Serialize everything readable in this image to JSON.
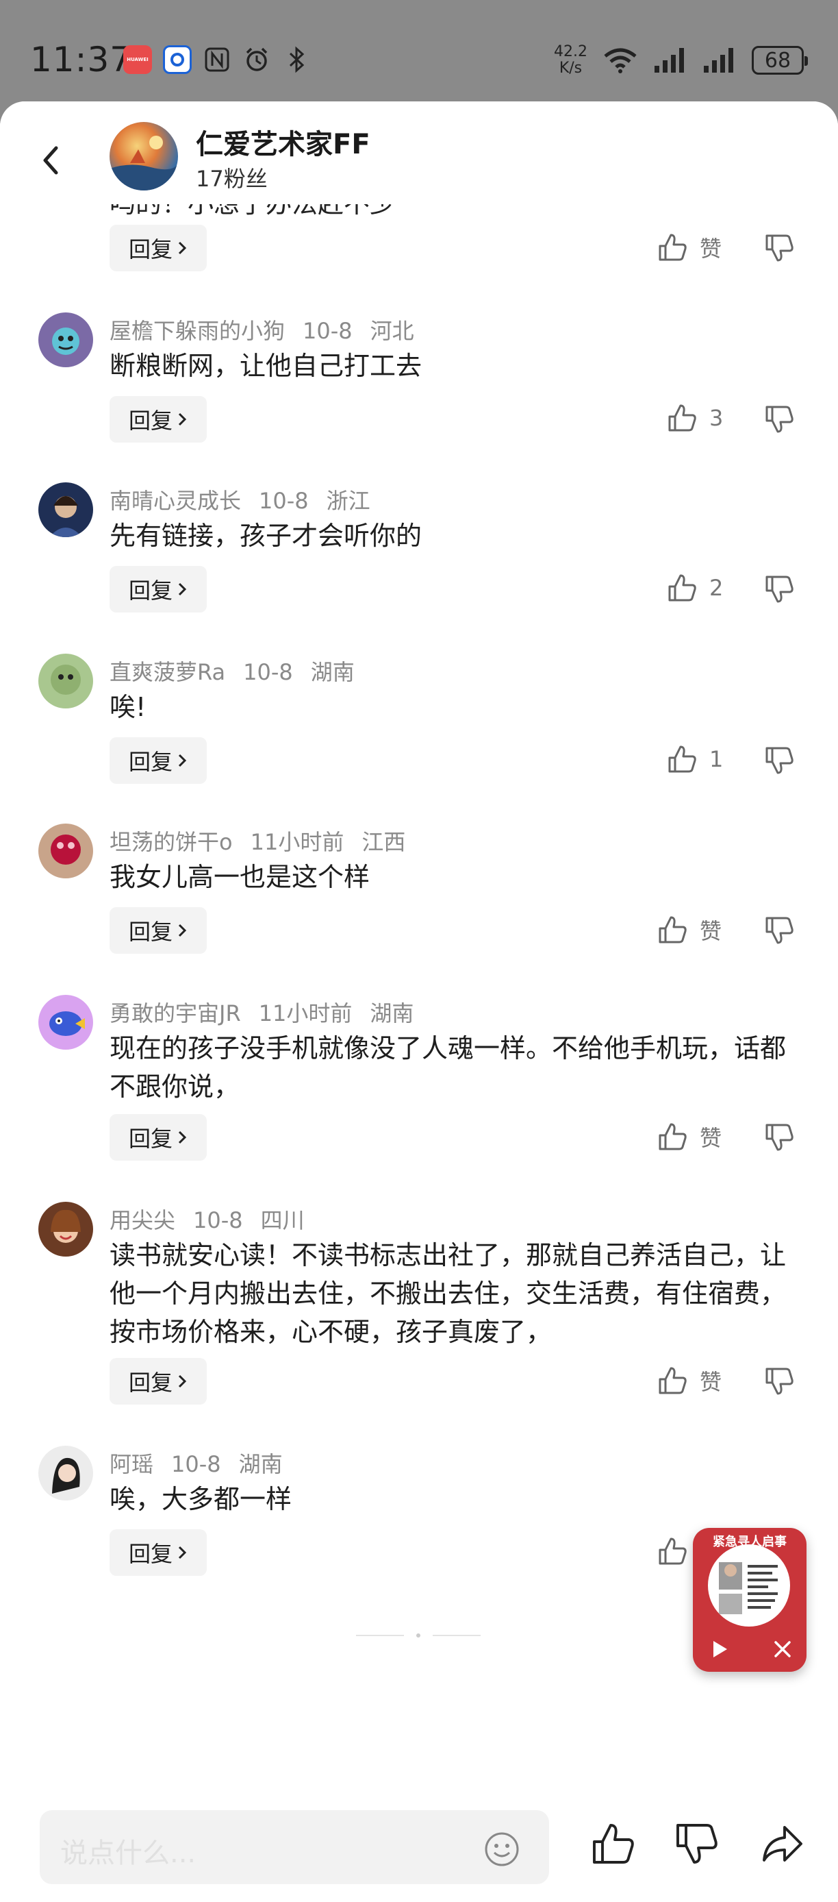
{
  "status_bar": {
    "time": "11:37",
    "app_badge": "HUAWEI",
    "net_speed_value": "42.2",
    "net_speed_unit": "K/s",
    "battery": "68"
  },
  "header": {
    "name": "仁爱艺术家FF",
    "fans": "17粉丝"
  },
  "clipped_top_text": "吗的！小想了办法赶不少",
  "top_reply": {
    "reply_label": "回复",
    "like_label": "赞"
  },
  "comments": [
    {
      "user": "屋檐下躲雨的小狗",
      "time": "10-8",
      "location": "河北",
      "text": "断粮断网，让他自己打工去",
      "reply_label": "回复",
      "likes": "3"
    },
    {
      "user": "南晴心灵成长",
      "time": "10-8",
      "location": "浙江",
      "text": "先有链接，孩子才会听你的",
      "reply_label": "回复",
      "likes": "2"
    },
    {
      "user": "直爽菠萝Ra",
      "time": "10-8",
      "location": "湖南",
      "text": "唉!",
      "reply_label": "回复",
      "likes": "1"
    },
    {
      "user": "坦荡的饼干o",
      "time": "11小时前",
      "location": "江西",
      "text": "我女儿高一也是这个样",
      "reply_label": "回复",
      "likes": "赞"
    },
    {
      "user": "勇敢的宇宙JR",
      "time": "11小时前",
      "location": "湖南",
      "text": "现在的孩子没手机就像没了人魂一样。不给他手机玩，话都不跟你说，",
      "reply_label": "回复",
      "likes": "赞"
    },
    {
      "user": "用尖尖",
      "time": "10-8",
      "location": "四川",
      "text": "读书就安心读！不读书标志出社了，那就自己养活自己，让他一个月内搬出去住，不搬出去住，交生活费，有住宿费，按市场价格来，心不硬，孩子真废了，",
      "reply_label": "回复",
      "likes": "赞"
    },
    {
      "user": "阿瑶",
      "time": "10-8",
      "location": "湖南",
      "text": "唉，大多都一样",
      "reply_label": "回复",
      "likes": ""
    }
  ],
  "float_player": {
    "title": "紧急寻人启事"
  },
  "bottom_bar": {
    "input_placeholder": "说点什么..."
  },
  "colors": {
    "accent_red": "#c9353a",
    "muted": "#8a8a8a"
  }
}
